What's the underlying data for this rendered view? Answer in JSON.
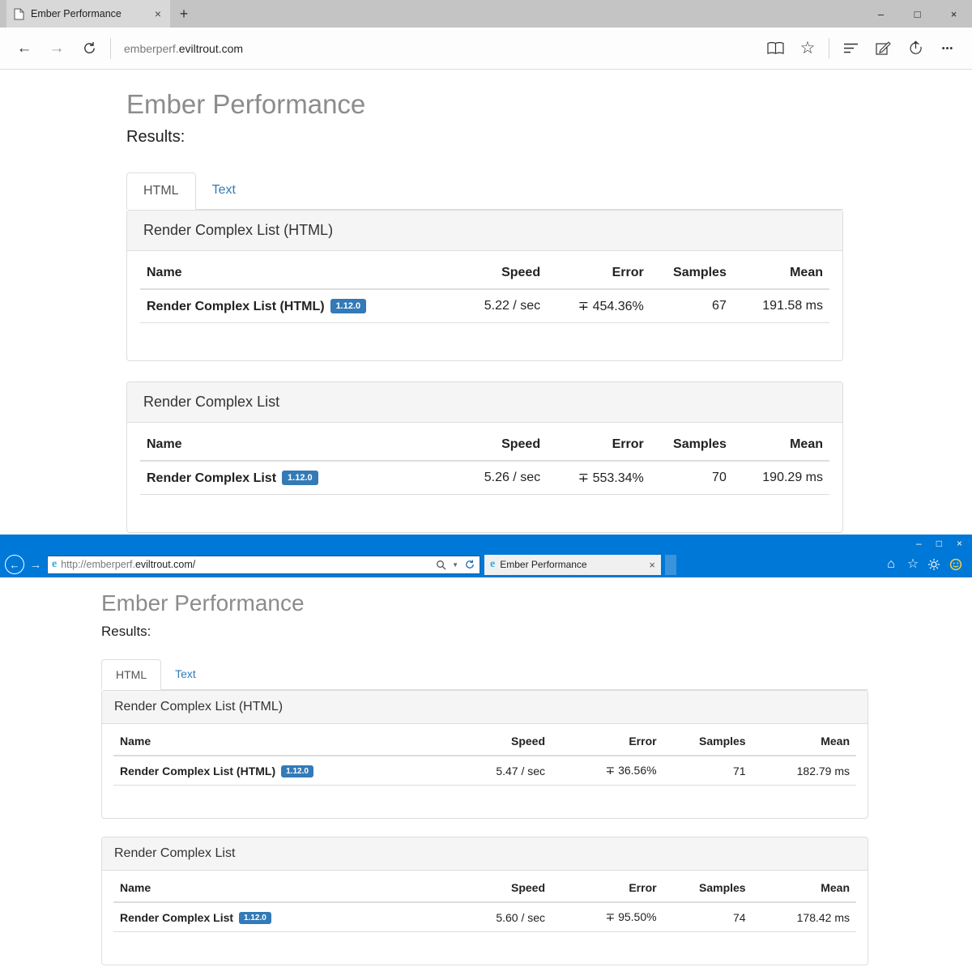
{
  "edge": {
    "tab": {
      "title": "Ember Performance"
    },
    "address": {
      "subdomain": "emberperf.",
      "domain": "eviltrout.com"
    },
    "page": {
      "title": "Ember Performance",
      "results_label": "Results:",
      "tabs": {
        "html": "HTML",
        "text": "Text"
      },
      "columns": {
        "name": "Name",
        "speed": "Speed",
        "error": "Error",
        "samples": "Samples",
        "mean": "Mean"
      },
      "panels": [
        {
          "title": "Render Complex List (HTML)",
          "row": {
            "name": "Render Complex List (HTML)",
            "version": "1.12.0",
            "speed": "5.22 / sec",
            "error": "∓ 454.36%",
            "samples": "67",
            "mean": "191.58 ms"
          }
        },
        {
          "title": "Render Complex List",
          "row": {
            "name": "Render Complex List",
            "version": "1.12.0",
            "speed": "5.26 / sec",
            "error": "∓ 553.34%",
            "samples": "70",
            "mean": "190.29 ms"
          }
        }
      ]
    }
  },
  "ie": {
    "tab": {
      "title": "Ember Performance"
    },
    "address": {
      "prefix": "http://emberperf.",
      "domain": "eviltrout.com/"
    },
    "page": {
      "title": "Ember Performance",
      "results_label": "Results:",
      "tabs": {
        "html": "HTML",
        "text": "Text"
      },
      "columns": {
        "name": "Name",
        "speed": "Speed",
        "error": "Error",
        "samples": "Samples",
        "mean": "Mean"
      },
      "panels": [
        {
          "title": "Render Complex List (HTML)",
          "row": {
            "name": "Render Complex List (HTML)",
            "version": "1.12.0",
            "speed": "5.47 / sec",
            "error": "∓ 36.56%",
            "samples": "71",
            "mean": "182.79 ms"
          }
        },
        {
          "title": "Render Complex List",
          "row": {
            "name": "Render Complex List",
            "version": "1.12.0",
            "speed": "5.60 / sec",
            "error": "∓ 95.50%",
            "samples": "74",
            "mean": "178.42 ms"
          }
        }
      ]
    }
  },
  "icons": {
    "close": "×",
    "new_tab": "+",
    "back_arrow": "←",
    "forward_arrow": "→",
    "star": "☆",
    "more": "•••",
    "minimize": "–",
    "maximize": "□",
    "home": "⌂",
    "caret": "▼",
    "ie_logo": "e"
  },
  "colors": {
    "accent_blue": "#337ab7",
    "ie_chrome_blue": "#0078d7",
    "panel_heading_bg": "#f5f5f5"
  }
}
